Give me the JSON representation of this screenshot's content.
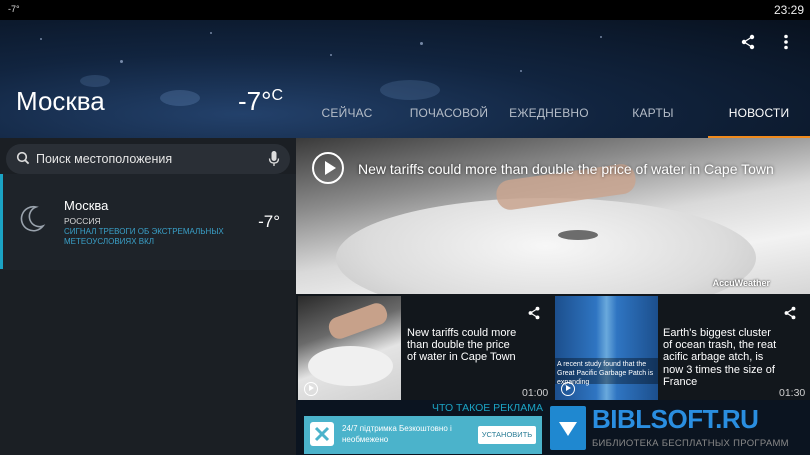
{
  "status_bar": {
    "left_text": "-7°",
    "time": "23:29"
  },
  "header": {
    "city": "Москва",
    "temperature": "-7°",
    "temperature_unit": "C",
    "actions": [
      "share-icon",
      "more-vert-icon"
    ]
  },
  "tabs": [
    {
      "label": "СЕЙЧАС",
      "active": false
    },
    {
      "label": "ПОЧАСОВОЙ",
      "active": false
    },
    {
      "label": "ЕЖЕДНЕВНО",
      "active": false
    },
    {
      "label": "КАРТЫ",
      "active": false
    },
    {
      "label": "НОВОСТИ",
      "active": true
    }
  ],
  "search": {
    "placeholder": "Поиск местоположения"
  },
  "location": {
    "name": "Москва",
    "country": "РОССИЯ",
    "alert": "СИГНАЛ ТРЕВОГИ ОБ ЭКСТРЕМАЛЬНЫХ МЕТЕОУСЛОВИЯХ ВКЛ",
    "temperature": "-7°",
    "icon": "moon-icon"
  },
  "main_video": {
    "title": "New tariffs could more than double the price of water in Cape Town",
    "brand": "AccuWeather"
  },
  "cards": [
    {
      "title": "New tariffs could more than double the price of water in Cape Town",
      "duration": "01:00"
    },
    {
      "title": "Earth's biggest cluster of ocean trash, the    reat    acific    arbage    atch, is now 3 times the size of France",
      "duration": "01:30",
      "thumb_caption": "A recent study found that the Great Pacific Garbage Patch is expanding"
    }
  ],
  "what_is_ad": "ЧТО ТАКОЕ РЕКЛАМА",
  "ad": {
    "text": "24/7 підтримка Безкоштовно і необмежено",
    "button": "УСТАНОВИТЬ"
  },
  "watermark": {
    "site": "BIBLSOFT.RU",
    "subtitle": "БИБЛИОТЕКА БЕСПЛАТНЫХ ПРОГРАММ"
  },
  "colors": {
    "accent": "#f08a1c",
    "link": "#1ba3c4",
    "panel": "#1b1f24"
  }
}
